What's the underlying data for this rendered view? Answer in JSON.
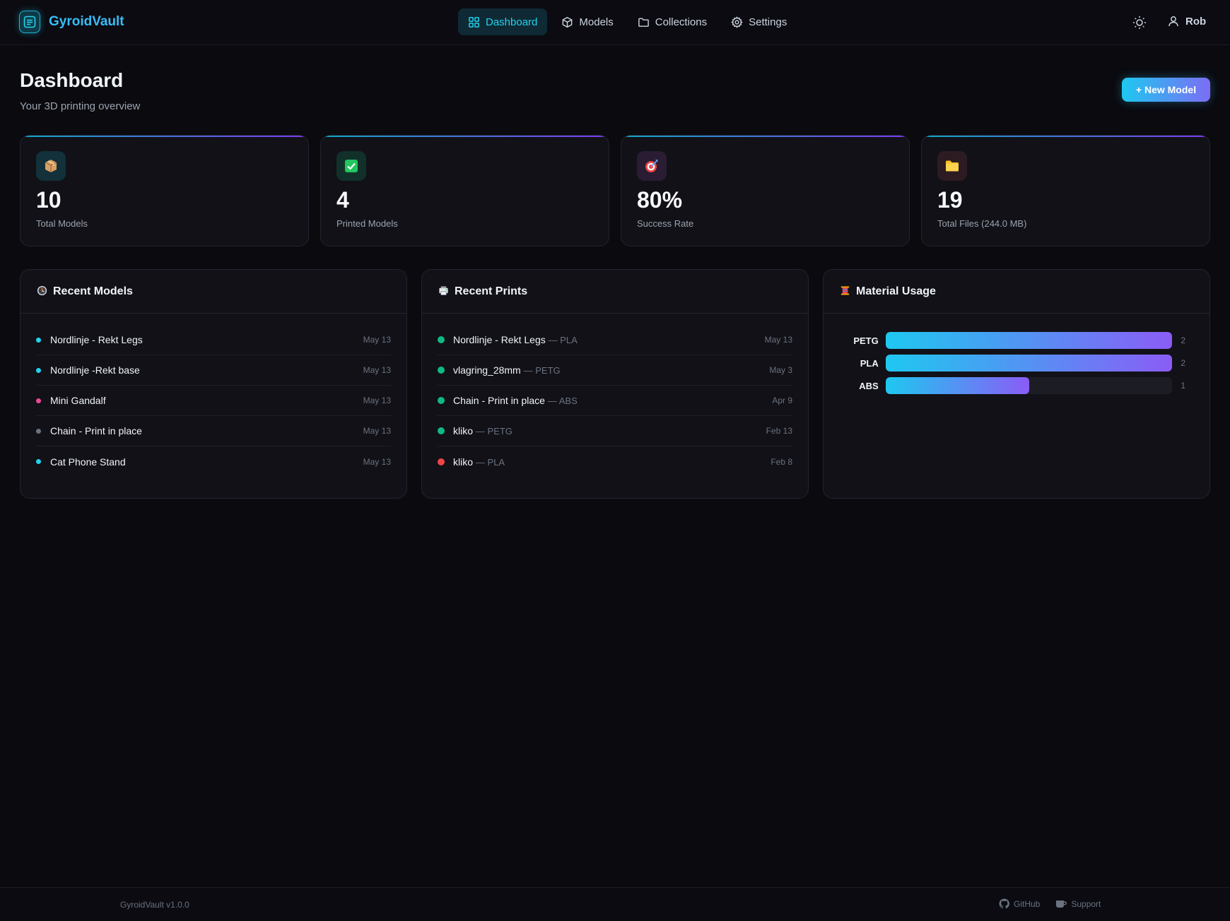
{
  "app": {
    "name": "GyroidVault"
  },
  "nav": [
    {
      "label": "Dashboard",
      "icon": "grid-icon",
      "active": true
    },
    {
      "label": "Models",
      "icon": "cube-icon",
      "active": false
    },
    {
      "label": "Collections",
      "icon": "folder-icon",
      "active": false
    },
    {
      "label": "Settings",
      "icon": "gear-icon",
      "active": false
    }
  ],
  "user": {
    "name": "Rob"
  },
  "header": {
    "title": "Dashboard",
    "subtitle": "Your 3D printing overview",
    "new_button": "+ New Model"
  },
  "stats": [
    {
      "value": "10",
      "label": "Total Models",
      "icon": "package-icon"
    },
    {
      "value": "4",
      "label": "Printed Models",
      "icon": "check-icon"
    },
    {
      "value": "80%",
      "label": "Success Rate",
      "icon": "target-icon"
    },
    {
      "value": "19",
      "label": "Total Files (244.0 MB)",
      "icon": "folder-icon"
    }
  ],
  "recent_models": {
    "title": "Recent Models",
    "icon": "clock-icon",
    "items": [
      {
        "name": "Nordlinje - Rekt Legs",
        "date": "May 13",
        "color": "#22d3ee"
      },
      {
        "name": "Nordlinje -Rekt base",
        "date": "May 13",
        "color": "#22d3ee"
      },
      {
        "name": "Mini Gandalf",
        "date": "May 13",
        "color": "#ec4899"
      },
      {
        "name": "Chain - Print in place",
        "date": "May 13",
        "color": "#6b7280"
      },
      {
        "name": "Cat Phone Stand",
        "date": "May 13",
        "color": "#22d3ee"
      }
    ]
  },
  "recent_prints": {
    "title": "Recent Prints",
    "icon": "printer-icon",
    "items": [
      {
        "name": "Nordlinje - Rekt Legs",
        "material": "— PLA",
        "date": "May 13",
        "color": "#10b981"
      },
      {
        "name": "vlagring_28mm",
        "material": "— PETG",
        "date": "May 3",
        "color": "#10b981"
      },
      {
        "name": "Chain - Print in place",
        "material": "— ABS",
        "date": "Apr 9",
        "color": "#10b981"
      },
      {
        "name": "kliko",
        "material": "— PETG",
        "date": "Feb 13",
        "color": "#10b981"
      },
      {
        "name": "kliko",
        "material": "— PLA",
        "date": "Feb 8",
        "color": "#ef4444"
      }
    ]
  },
  "material_usage": {
    "title": "Material Usage",
    "icon": "spool-icon",
    "items": [
      {
        "label": "PETG",
        "count": "2",
        "fraction": 1.0
      },
      {
        "label": "PLA",
        "count": "2",
        "fraction": 1.0
      },
      {
        "label": "ABS",
        "count": "1",
        "fraction": 0.5
      }
    ]
  },
  "footer": {
    "version": "GyroidVault v1.0.0",
    "github": "GitHub",
    "support": "Support"
  }
}
